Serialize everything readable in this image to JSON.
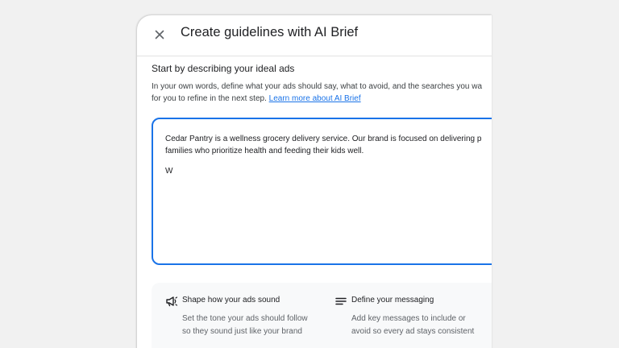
{
  "dialog": {
    "title": "Create guidelines with AI Brief",
    "close_icon": "close-icon"
  },
  "intro": {
    "heading": "Start by describing your ideal ads",
    "description_line1": "In your own words, define what your ads should say, what to avoid, and the searches you wa",
    "description_line2": "for you to refine in the next step.",
    "learn_more_link": "Learn more about AI Brief"
  },
  "brief_input": {
    "line1": "Cedar Pantry is a wellness grocery delivery service. Our brand is focused on delivering p",
    "line2": "families who prioritize health and feeding their kids well.",
    "typed": "W"
  },
  "tips": [
    {
      "icon": "megaphone-icon",
      "title": "Shape how your ads sound",
      "body_line1": "Set the tone your ads should follow",
      "body_line2": "so they sound just like your brand"
    },
    {
      "icon": "lines-icon",
      "title": "Define your messaging",
      "body_line1": "Add key messages to include or",
      "body_line2": "avoid so every ad stays consistent"
    }
  ],
  "colors": {
    "accent": "#1a73e8",
    "text": "#202124",
    "muted": "#5f6368",
    "tips_bg": "#f8f9fa",
    "backdrop": "#f1f1f1"
  }
}
